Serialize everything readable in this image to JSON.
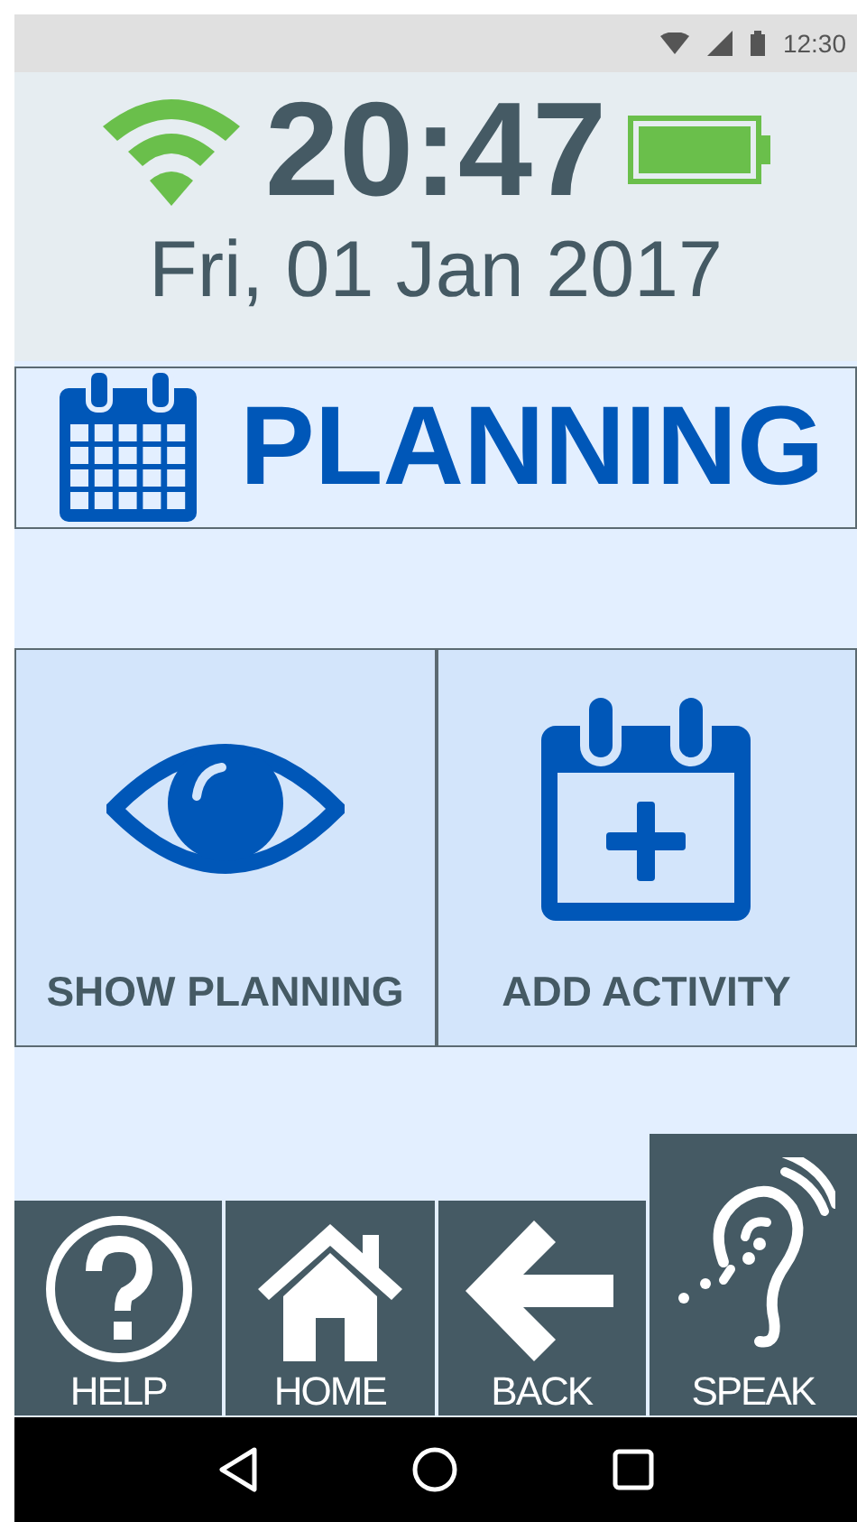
{
  "status_bar": {
    "time": "12:30"
  },
  "header": {
    "time": "20:47",
    "date": "Fri, 01 Jan 2017",
    "battery": {
      "level": 1
    }
  },
  "title_bar": {
    "title": "PLANNING"
  },
  "tiles": [
    {
      "kind": "eye",
      "label": "SHOW PLANNING"
    },
    {
      "kind": "calendar-plus",
      "label": "ADD ACTIVITY"
    }
  ],
  "bottom_buttons": [
    {
      "kind": "help",
      "label": "HELP",
      "selected": false
    },
    {
      "kind": "home",
      "label": "HOME",
      "selected": false
    },
    {
      "kind": "back",
      "label": "BACK",
      "selected": false
    },
    {
      "kind": "ear",
      "label": "SPEAK",
      "selected": true
    }
  ]
}
